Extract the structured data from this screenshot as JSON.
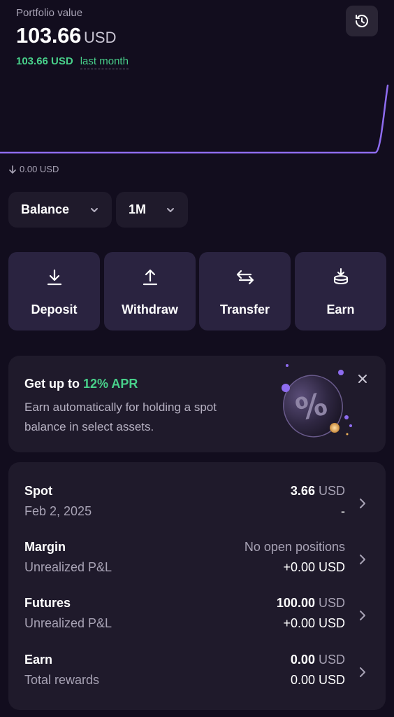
{
  "header": {
    "label": "Portfolio value",
    "value": "103.66",
    "currency": "USD",
    "change_amount": "103.66 USD",
    "change_period": "last month"
  },
  "chart": {
    "min_label": "0.00 USD",
    "line_color": "#8e6cf0"
  },
  "chart_data": {
    "type": "line",
    "x": [
      0,
      1,
      2,
      3,
      4,
      5,
      6,
      7,
      8,
      9,
      10,
      11,
      12,
      13,
      14,
      15,
      16,
      17,
      18,
      19,
      20,
      21,
      22,
      23,
      24,
      25,
      26,
      27,
      28,
      29,
      30
    ],
    "values": [
      0,
      0,
      0,
      0,
      0,
      0,
      0,
      0,
      0,
      0,
      0,
      0,
      0,
      0,
      0,
      0,
      0,
      0,
      0,
      0,
      0,
      0,
      0,
      0,
      0,
      0,
      0,
      0,
      0,
      0,
      103.66
    ],
    "xlabel": "",
    "ylabel": "",
    "grid": false
  },
  "selectors": {
    "view": "Balance",
    "range": "1M"
  },
  "actions": [
    {
      "label": "Deposit",
      "icon": "download-icon"
    },
    {
      "label": "Withdraw",
      "icon": "upload-icon"
    },
    {
      "label": "Transfer",
      "icon": "transfer-arrows-icon"
    },
    {
      "label": "Earn",
      "icon": "coin-stack-icon"
    }
  ],
  "promo": {
    "title_prefix": "Get up to ",
    "title_highlight": "12% APR",
    "description": "Earn automatically for holding a spot balance in select assets.",
    "art_icon": "percent-coin-icon"
  },
  "accounts": [
    {
      "name": "Spot",
      "sub": "Feb 2, 2025",
      "val1_num": "3.66",
      "val1_cur": "USD",
      "val2": "-"
    },
    {
      "name": "Margin",
      "sub": "Unrealized P&L",
      "val1_text": "No open positions",
      "val2": "+0.00 USD"
    },
    {
      "name": "Futures",
      "sub": "Unrealized P&L",
      "val1_num": "100.00",
      "val1_cur": "USD",
      "val2": "+0.00 USD"
    },
    {
      "name": "Earn",
      "sub": "Total rewards",
      "val1_num": "0.00",
      "val1_cur": "USD",
      "val2": "0.00 USD"
    }
  ],
  "colors": {
    "background": "#120d1e",
    "card": "#1f1a2b",
    "action_card": "#2a2340",
    "positive": "#48d08a",
    "accent": "#8e6cf0"
  }
}
